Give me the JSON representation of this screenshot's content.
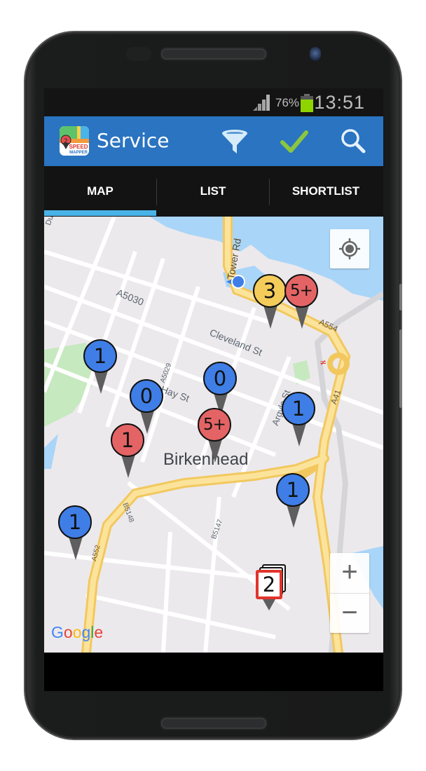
{
  "status_bar": {
    "signal_icon": "cell-signal-icon",
    "battery_percent": "76%",
    "battery_icon": "battery-icon",
    "battery_color": "#8fd400",
    "time": "13:51"
  },
  "app_bar": {
    "logo_icon": "speed-mapper-logo",
    "logo_badge": "2",
    "logo_text_line1": "SPEED",
    "logo_text_line2": "MAPPER",
    "title": "Service",
    "background_color": "#2a74c1",
    "actions": [
      {
        "name": "filter",
        "icon": "funnel-icon"
      },
      {
        "name": "confirm",
        "icon": "checkmark-icon",
        "color": "#8cc63f"
      },
      {
        "name": "search",
        "icon": "search-icon"
      }
    ]
  },
  "tabs": {
    "items": [
      {
        "label": "MAP",
        "selected": true
      },
      {
        "label": "LIST",
        "selected": false
      },
      {
        "label": "SHORTLIST",
        "selected": false
      }
    ],
    "indicator_color": "#49b2e6"
  },
  "map": {
    "labels": {
      "city": "Birkenhead",
      "streets": [
        "Duke St",
        "Tower Rd",
        "A5030",
        "Cleveland St",
        "A554",
        "A5029",
        "Hay St",
        "Argyle St",
        "A41",
        "B5148",
        "A552",
        "B5147"
      ]
    },
    "markers": [
      {
        "count": "3",
        "color": "yellow"
      },
      {
        "count": "5+",
        "color": "red"
      },
      {
        "count": "1",
        "color": "blue"
      },
      {
        "count": "0",
        "color": "blue"
      },
      {
        "count": "0",
        "color": "blue"
      },
      {
        "count": "1",
        "color": "red"
      },
      {
        "count": "5+",
        "color": "red"
      },
      {
        "count": "1",
        "color": "blue"
      },
      {
        "count": "1",
        "color": "blue"
      },
      {
        "count": "1",
        "color": "blue"
      }
    ],
    "stacked_marker": {
      "count": "2"
    },
    "my_location_icon": "my-location-icon",
    "zoom_in": "+",
    "zoom_out": "−",
    "attribution": "Google"
  }
}
